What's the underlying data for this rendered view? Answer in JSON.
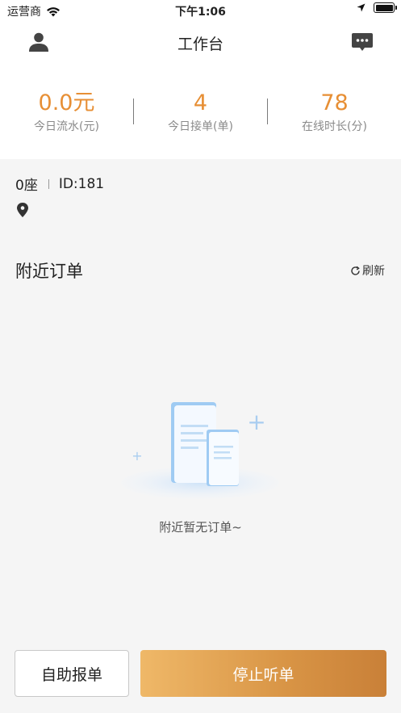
{
  "status_bar": {
    "carrier": "运营商",
    "time": "下午1:06"
  },
  "nav": {
    "title": "工作台",
    "left_icon": "user-icon",
    "right_icon": "message-icon"
  },
  "stats": [
    {
      "value": "0.0元",
      "label": "今日流水(元)"
    },
    {
      "value": "4",
      "label": "今日接单(单)"
    },
    {
      "value": "78",
      "label": "在线时长(分)"
    }
  ],
  "driver": {
    "seat": "0座",
    "id": "ID:181"
  },
  "nearby": {
    "title": "附近订单",
    "refresh_label": "刷新",
    "empty_text": "附近暂无订单~"
  },
  "actions": {
    "self_report": "自助报单",
    "stop_listening": "停止听单"
  },
  "colors": {
    "accent": "#e78f35",
    "button_gradient_start": "#efb868",
    "button_gradient_end": "#c98038"
  }
}
